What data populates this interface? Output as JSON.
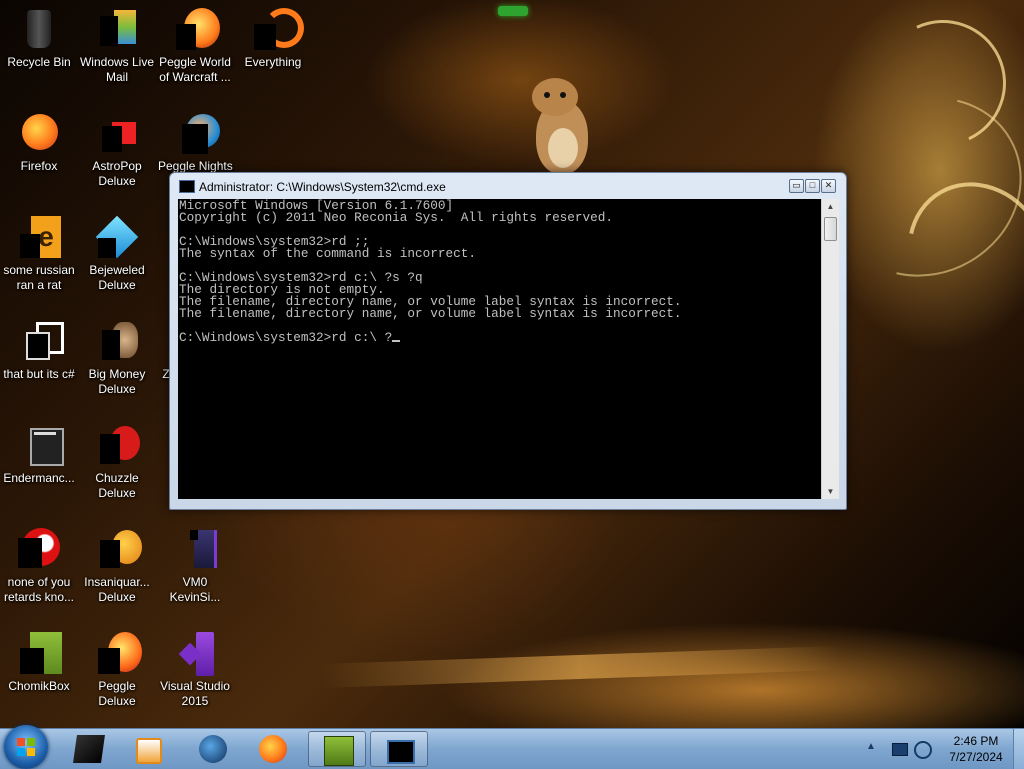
{
  "desktop": {
    "icons": [
      {
        "label": "Recycle Bin",
        "icon": "recycle-bin-icon"
      },
      {
        "label": "Windows Live Mail",
        "icon": "windows-live-mail-icon"
      },
      {
        "label": "Peggle World of Warcraft ...",
        "icon": "peggle-wow-icon"
      },
      {
        "label": "Everything",
        "icon": "everything-search-icon"
      },
      {
        "label": "Firefox",
        "icon": "firefox-icon"
      },
      {
        "label": "AstroPop Deluxe",
        "icon": "astropop-icon"
      },
      {
        "label": "Peggle Nights",
        "icon": "peggle-nights-icon"
      },
      {
        "label": "some russian ran a rat",
        "icon": "shortcut-e-icon"
      },
      {
        "label": "Bejeweled Deluxe",
        "icon": "bejeweled-icon"
      },
      {
        "label": "that but its c#",
        "icon": "window-stack-icon"
      },
      {
        "label": "Big Money Deluxe",
        "icon": "big-money-icon"
      },
      {
        "label": "Z",
        "icon": "partial-icon"
      },
      {
        "label": "Endermanc...",
        "icon": "endermanch-icon"
      },
      {
        "label": "Chuzzle Deluxe",
        "icon": "chuzzle-icon"
      },
      {
        "label": "none of you retards kno...",
        "icon": "red-app-icon"
      },
      {
        "label": "Insaniquar... Deluxe",
        "icon": "insaniquarium-icon"
      },
      {
        "label": "VM0 KevinSi...",
        "icon": "vm-file-icon"
      },
      {
        "label": "ChomikBox",
        "icon": "chomikbox-icon"
      },
      {
        "label": "Peggle Deluxe",
        "icon": "peggle-deluxe-icon"
      },
      {
        "label": "Visual Studio 2015",
        "icon": "visual-studio-icon"
      }
    ]
  },
  "cmd": {
    "title": "Administrator: C:\\Windows\\System32\\cmd.exe",
    "buttons": {
      "minimize": "▭",
      "maximize": "□",
      "close": "✕"
    },
    "lines": [
      "Microsoft Windows [Version 6.1.7600]",
      "Copyright (c) 2011 Neo Reconia Sys.  All rights reserved.",
      "",
      "C:\\Windows\\system32>rd ;;",
      "The syntax of the command is incorrect.",
      "",
      "C:\\Windows\\system32>rd c:\\ ?s ?q",
      "The directory is not empty.",
      "The filename, directory name, or volume label syntax is incorrect.",
      "The filename, directory name, or volume label syntax is incorrect.",
      ""
    ],
    "prompt": "C:\\Windows\\system32>rd c:\\ ?"
  },
  "taskbar": {
    "start": "start-orb-icon",
    "pinned": [
      {
        "name": "taskbar-cmd-pinned",
        "icon": "terminal-icon"
      },
      {
        "name": "taskbar-media-player",
        "icon": "media-player-icon"
      },
      {
        "name": "taskbar-network-globe",
        "icon": "globe-icon"
      },
      {
        "name": "taskbar-firefox",
        "icon": "firefox-icon"
      },
      {
        "name": "taskbar-chomikbox",
        "icon": "chomikbox-icon"
      },
      {
        "name": "taskbar-cmd-window",
        "icon": "cmd-window-icon"
      }
    ],
    "clock": {
      "time": "2:46 PM",
      "date": "7/27/2024"
    },
    "colors": {
      "taskbar": "#7fa6cf",
      "console_bg": "#000000",
      "console_text": "#c0c0c0"
    }
  }
}
